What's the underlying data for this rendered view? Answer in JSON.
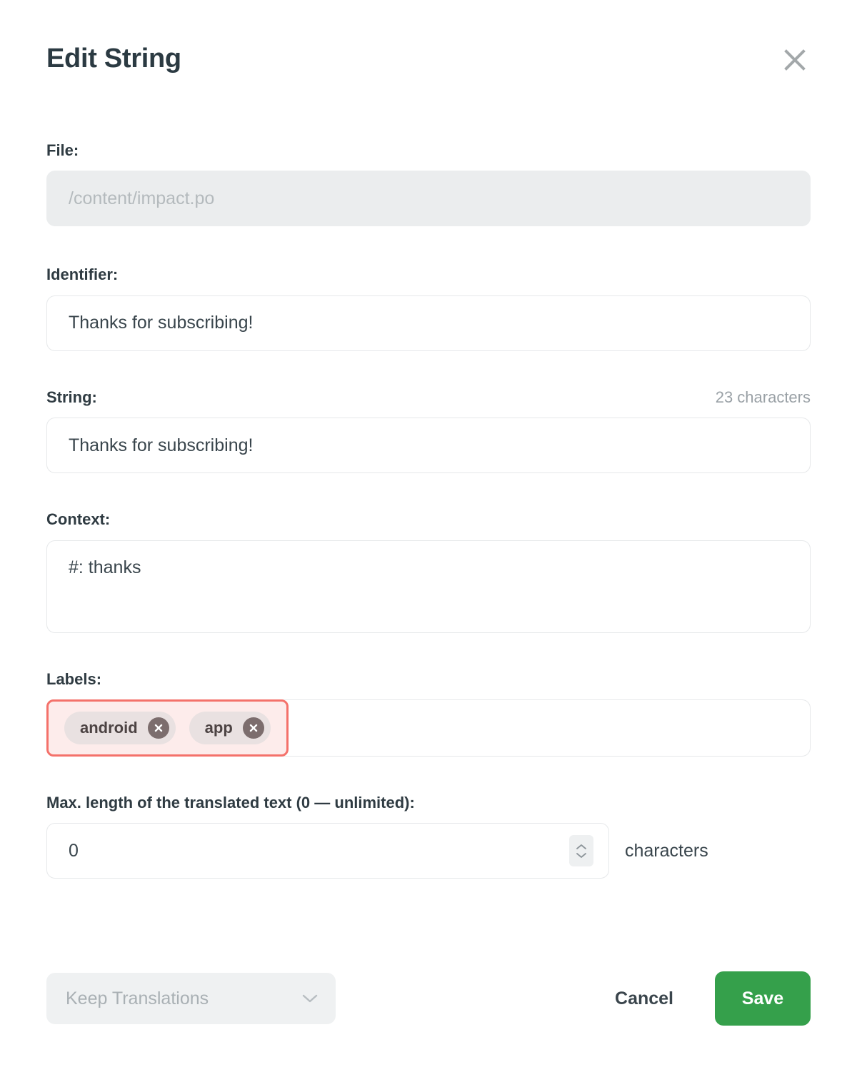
{
  "dialog": {
    "title": "Edit String",
    "close_icon": "close-icon"
  },
  "fields": {
    "file": {
      "label": "File:",
      "value": "/content/impact.po",
      "disabled": true
    },
    "identifier": {
      "label": "Identifier:",
      "value": "Thanks for subscribing!"
    },
    "string": {
      "label": "String:",
      "value": "Thanks for subscribing!",
      "char_count": "23 characters"
    },
    "context": {
      "label": "Context:",
      "value": "#: thanks"
    },
    "labels": {
      "label": "Labels:",
      "tags": [
        {
          "name": "android",
          "remove_icon": "close-circle-icon"
        },
        {
          "name": "app",
          "remove_icon": "close-circle-icon"
        }
      ],
      "highlight_border_color": "#f4716a",
      "highlight_fill_color": "#fdeceb"
    },
    "max_length": {
      "label": "Max. length of the translated text (0 — unlimited):",
      "value": "0",
      "unit": "characters",
      "spinner_icon": "updown-chevrons-icon"
    }
  },
  "footer": {
    "keep_translations": {
      "label": "Keep Translations",
      "chevron_icon": "chevron-down-icon",
      "disabled": true
    },
    "cancel_label": "Cancel",
    "save_label": "Save",
    "save_color": "#35a04b"
  }
}
